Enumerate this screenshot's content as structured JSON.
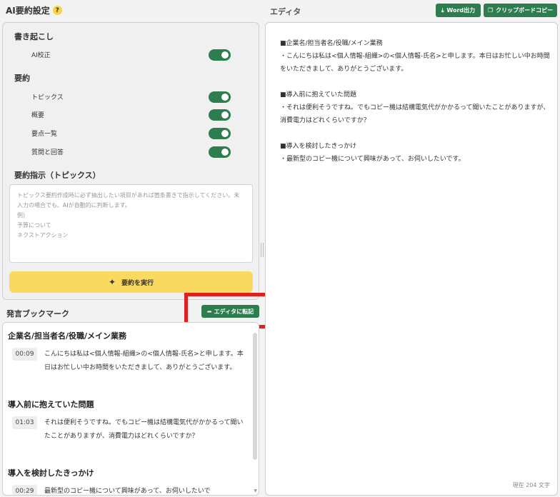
{
  "settings": {
    "title": "AI要約設定",
    "help": "?",
    "transcription": {
      "heading": "書き起こし",
      "ai_proofread": {
        "label": "AI校正",
        "on": true
      }
    },
    "summary": {
      "heading": "要約",
      "items": [
        {
          "label": "トピックス",
          "on": true
        },
        {
          "label": "概要",
          "on": true
        },
        {
          "label": "要点一覧",
          "on": true
        },
        {
          "label": "質問と回答",
          "on": true
        }
      ]
    },
    "instruction": {
      "heading": "要約指示（トピックス）",
      "placeholder": "トピックス要約作成時に必ず抽出したい項目があれば箇条書きで指示してください。未入力の場合でも、AIが自動的に判断します。\n例)\n予算について\nネクストアクション"
    },
    "run_button": "要約を実行"
  },
  "bookmarks": {
    "title": "発言ブックマーク",
    "transfer_button": "エディタに転記",
    "sections": [
      {
        "heading": "企業名/担当者名/役職/メイン業務",
        "time": "00:09",
        "text": "こんにちは私は<個人情報-組織>の<個人情報-氏名>と申します。本日はお忙しい中お時間をいただきまして、ありがとうございます。"
      },
      {
        "heading": "導入前に抱えていた問題",
        "time": "01:03",
        "text": "それは便利そうですね。でもコピー機は結構電気代がかかるって聞いたことがありますが、消費電力はどれくらいですか？"
      },
      {
        "heading": "導入を検討したきっかけ",
        "time": "00:29",
        "text": "最新型のコピー機について興味があって、お伺いしたいで"
      }
    ]
  },
  "editor": {
    "title": "エディタ",
    "word_button": "Word出力",
    "clipboard_button": "クリップボードコピー",
    "content": "■企業名/担当者名/役職/メイン業務\n・こんにちは私は<個人情報-組織>の<個人情報-氏名>と申します。本日はお忙しい中お時間をいただきまして、ありがとうございます。\n\n■導入前に抱えていた問題\n・それは便利そうですね。でもコピー機は結構電気代がかかるって聞いたことがありますが、消費電力はどれくらいですか？\n\n■導入を検討したきっかけ\n・最新型のコピー機について興味があって、お伺いしたいです。",
    "char_count": "現在 204 文字"
  },
  "colors": {
    "accent_green": "#2e7d4f",
    "run_yellow": "#fad960",
    "highlight_red": "#e02020"
  },
  "icons": {
    "help": "question-circle-icon",
    "run": "magic-wand-icon",
    "transfer": "arrow-forward-icon",
    "word": "download-icon",
    "clipboard": "copy-icon"
  }
}
